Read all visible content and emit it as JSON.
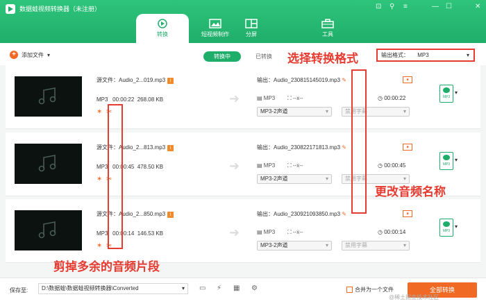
{
  "app": {
    "title": "数据蛙视频转换器（未注册）"
  },
  "window_controls": [
    "⊡",
    "⚲",
    "≡",
    "—",
    "☐",
    "✕"
  ],
  "tabs": [
    {
      "label": "转换",
      "active": true,
      "icon": "convert-icon"
    },
    {
      "label": "短视频制作",
      "active": false,
      "icon": "image-icon"
    },
    {
      "label": "分屏",
      "active": false,
      "icon": "split-screen-icon"
    },
    {
      "label": "工具",
      "active": false,
      "icon": "toolbox-icon"
    }
  ],
  "toolbar": {
    "add_label": "添加文件",
    "segment_converting": "转换中",
    "segment_converted": "已转换",
    "output_format_label": "输出格式：",
    "output_format_value": "MP3"
  },
  "rows": [
    {
      "source": "源文件：Audio_2...019.mp3",
      "format": "MP3",
      "duration": "00:00:22",
      "size": "268.08 KB",
      "output": "输出：Audio_230815145019.mp3",
      "ofmt": "MP3",
      "oratio": "--x--",
      "odur": "00:00:22",
      "channel": "MP3-2声道",
      "subtitle": "禁用字幕"
    },
    {
      "source": "源文件：Audio_2...813.mp3",
      "format": "MP3",
      "duration": "00:00:45",
      "size": "478.50 KB",
      "output": "输出：Audio_230822171813.mp3",
      "ofmt": "MP3",
      "oratio": "--x--",
      "odur": "00:00:45",
      "channel": "MP3-2声道",
      "subtitle": "禁用字幕"
    },
    {
      "source": "源文件：Audio_2...850.mp3",
      "format": "MP3",
      "duration": "00:00:14",
      "size": "146.53 KB",
      "output": "输出：Audio_230921093850.mp3",
      "ofmt": "MP3",
      "oratio": "--x--",
      "odur": "00:00:14",
      "channel": "MP3-2声道",
      "subtitle": "禁用字幕"
    }
  ],
  "annotations": {
    "select_format": "选择转换格式",
    "rename_audio": "更改音频名称",
    "trim_audio": "剪掉多余的音频片段"
  },
  "footer": {
    "save_to_label": "保存至:",
    "save_path": "D:\\数据蛙\\数据蛙视频转换器\\Converted",
    "merge_label": "合并为一个文件",
    "convert_all": "全部转换"
  },
  "watermark": "@稀土掘金技术社区",
  "colors": {
    "brand_green": "#1fae6a",
    "accent_orange": "#f06a25",
    "annotation_red": "#e53b30"
  }
}
